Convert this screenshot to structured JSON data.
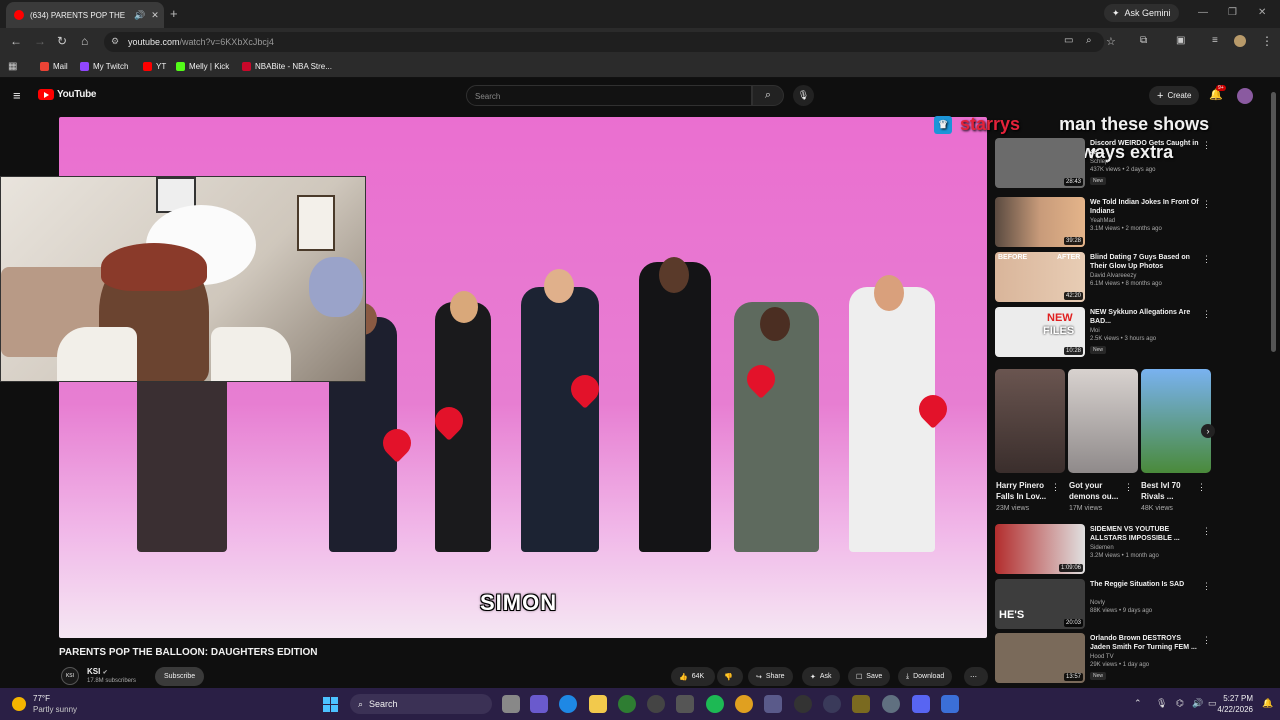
{
  "browser": {
    "tab_title": "(634) PARENTS POP THE BA",
    "new_tab": "+",
    "gemini_label": "Ask Gemini",
    "url_domain": "youtube.com",
    "url_path": "/watch?v=6KXbXcJbcj4",
    "bookmarks": [
      {
        "label": "Mail",
        "color": "#ea4335"
      },
      {
        "label": "My Twitch",
        "color": "#9146ff"
      },
      {
        "label": "YT",
        "color": "#ff0000"
      },
      {
        "label": "Melly | Kick",
        "color": "#53fc18"
      },
      {
        "label": "NBABite - NBA Stre...",
        "color": "#c9082a"
      }
    ]
  },
  "youtube": {
    "logo_text": "YouTube",
    "search_placeholder": "Search",
    "create_label": "Create",
    "notif_count": "9+"
  },
  "video": {
    "caption": "SIMON",
    "title": "PARENTS POP THE BALLOON: DAUGHTERS EDITION",
    "channel": "KSI",
    "channel_avatar_text": "KSI",
    "subscribers": "17.8M subscribers",
    "subscribe_label": "Subscribe",
    "likes": "64K",
    "share_label": "Share",
    "ask_label": "Ask",
    "save_label": "Save",
    "download_label": "Download"
  },
  "chat": {
    "username": "starrys",
    "message_line1": "man these shows",
    "message_line2": "always extra"
  },
  "recommendations": [
    {
      "title": "Discord WEIRDO Gets Caught in 4K...",
      "channel": "Schlep",
      "meta": "437K views • 2 days ago",
      "badge": "New",
      "duration": "28:43",
      "thumb": "#6b6b6b"
    },
    {
      "title": "We Told Indian Jokes In Front Of Indians",
      "channel": "YeahMad",
      "meta": "3.1M views • 2 months ago",
      "badge": "",
      "duration": "39:28",
      "thumb": "#b58a6a"
    },
    {
      "title": "Blind Dating 7 Guys Based on Their Glow Up Photos",
      "channel": "David Alvareeezy",
      "meta": "6.1M views • 8 months ago",
      "badge": "",
      "duration": "42:20",
      "thumb": "#d8b08f"
    },
    {
      "title": "NEW Sykkuno Allegations Are BAD...",
      "channel": "Moi",
      "meta": "2.5K views • 3 hours ago",
      "badge": "New",
      "duration": "10:28",
      "thumb": "#e6e6e6"
    },
    {
      "title": "SIDEMEN VS YOUTUBE ALLSTARS IMPOSSIBLE ...",
      "channel": "Sidemen",
      "meta": "3.2M views • 1 month ago",
      "badge": "",
      "duration": "1:09:06",
      "thumb": "#b32d2d"
    },
    {
      "title": "The Reggie Situation Is SAD",
      "channel": "Novly",
      "meta": "88K views • 9 days ago",
      "badge": "",
      "duration": "20:03",
      "thumb": "#3d3d3d"
    },
    {
      "title": "Orlando Brown DESTROYS Jaden Smith For Turning FEM ...",
      "channel": "Hood TV",
      "meta": "29K views • 1 day ago",
      "badge": "New",
      "duration": "13:57",
      "thumb": "#7a6a5a"
    }
  ],
  "shorts": [
    {
      "title": "Harry Pinero Falls In Lov...",
      "views": "23M views",
      "thumb": "#5a4a45"
    },
    {
      "title": "Got your demons ou...",
      "views": "17M views",
      "thumb": "#c9c2bf"
    },
    {
      "title": "Best lvl 70 Rivals ...",
      "views": "48K views",
      "thumb": "#6aa0e0"
    }
  ],
  "thumb_text": {
    "before": "BEFORE",
    "after": "AFTER",
    "new": "NEW",
    "files": "FILES",
    "hes": "HE'S"
  },
  "taskbar": {
    "temp": "77°F",
    "weather": "Partly sunny",
    "search_label": "Search",
    "time": "5:27 PM",
    "date": "4/22/2026"
  }
}
